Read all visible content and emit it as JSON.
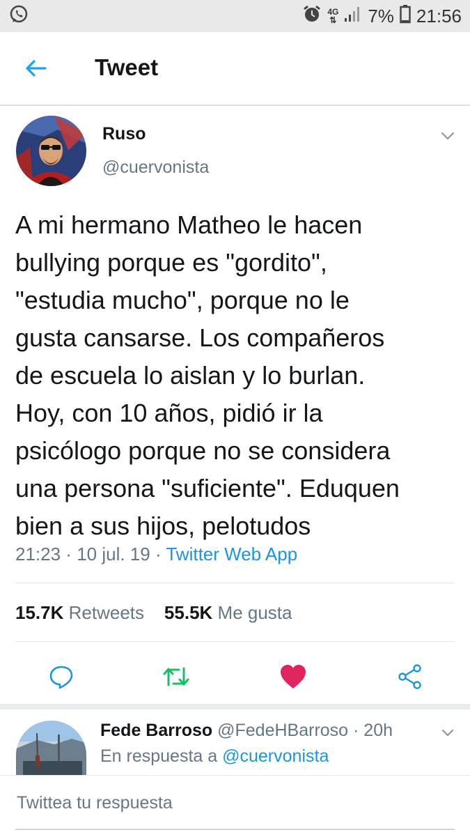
{
  "status_bar": {
    "network_top": "4G",
    "network_bottom": "⇅",
    "battery": "7%",
    "time": "21:56",
    "icons": [
      "whatsapp-icon",
      "alarm-icon",
      "signal-icon",
      "battery-icon"
    ]
  },
  "header": {
    "title": "Tweet",
    "accent": "#1da1f2"
  },
  "tweet": {
    "name": "Ruso",
    "handle": "@cuervonista",
    "text_lines": [
      "A mi hermano Matheo le hacen",
      "bullying porque es \"gordito\",",
      "\"estudia mucho\", porque no le",
      "gusta cansarse. Los compañeros",
      "de escuela lo aislan y lo burlan.",
      "Hoy, con 10 años, pidió ir la",
      "psicólogo porque no se considera",
      "una persona \"suficiente\". Eduquen",
      "bien a sus hijos, pelotudos"
    ],
    "time": "21:23",
    "date": "10 jul. 19",
    "separator": " · ",
    "source": "Twitter Web App",
    "retweets_count": "15.7K",
    "retweets_label": "Retweets",
    "likes_count": "55.5K",
    "likes_label": "Me gusta",
    "action_icons": [
      "reply-icon",
      "retweet-icon",
      "heart-icon",
      "share-icon"
    ],
    "colors": {
      "retweet": "#17bf63",
      "like": "#e0245e",
      "link": "#1b95e0",
      "muted": "#657786"
    }
  },
  "reply": {
    "name": "Fede Barroso",
    "handle": "@FedeHBarroso",
    "age": "20h",
    "reply_to_label": "En respuesta a",
    "reply_to_handle": "@cuervonista"
  },
  "composer": {
    "placeholder": "Twittea tu respuesta"
  }
}
